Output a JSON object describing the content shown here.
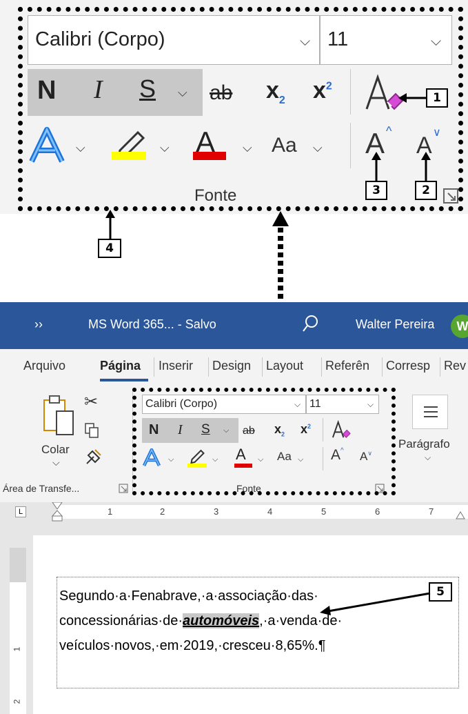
{
  "zoomed_font_group": {
    "font_name": "Calibri (Corpo)",
    "font_size": "11",
    "bold": "N",
    "italic": "I",
    "underline": "S",
    "strikethrough": "ab",
    "subscript": "x",
    "subscript_mark": "2",
    "superscript": "x",
    "superscript_mark": "2",
    "case_button": "Aa",
    "grow_font": "A",
    "shrink_font": "A",
    "group_label": "Fonte",
    "highlight_color": "#ffff00",
    "font_color": "#e00000"
  },
  "callouts": {
    "c1": "1",
    "c2": "2",
    "c3": "3",
    "c4": "4",
    "c5": "5"
  },
  "titlebar": {
    "more": "››",
    "title": "MS Word 365...  - Salvo",
    "user": "Walter Pereira",
    "avatar": "W"
  },
  "tabs": [
    "Arquivo",
    "Página",
    "Inserir",
    "Design",
    "Layout",
    "Referên",
    "Corresp",
    "Rev"
  ],
  "ribbon": {
    "paste_label": "Colar",
    "clipboard_group": "Área de Transfe...",
    "font_name": "Calibri (Corpo)",
    "font_size": "11",
    "bold": "N",
    "italic": "I",
    "underline": "S",
    "strikethrough": "ab",
    "subscript": "x",
    "subscript_mark": "2",
    "superscript": "x",
    "superscript_mark": "2",
    "case_button": "Aa",
    "font_group": "Fonte",
    "paragraph_label": "Parágrafo"
  },
  "ruler": {
    "marks": [
      "1",
      "2",
      "3",
      "4",
      "5",
      "6",
      "7"
    ],
    "vertical_marks": [
      "1",
      "2"
    ]
  },
  "document": {
    "line1": "Segundo·a·Fenabrave,·a·associação·das·",
    "line2_pre": "concessionárias·de·",
    "line2_sel": "automóveis",
    "line2_post": ",·a·venda·de·",
    "line3": "veículos·novos,·em·2019,·cresceu·8,65%.¶"
  }
}
